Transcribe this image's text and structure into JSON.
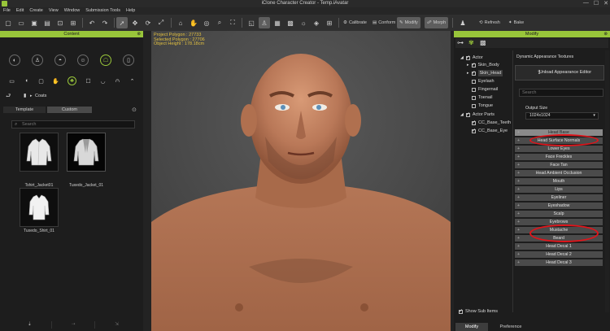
{
  "window": {
    "title": "iClone Character Creator - Temp.iAvatar",
    "controls": [
      "—",
      "☐",
      "✕"
    ]
  },
  "menu": [
    "File",
    "Edit",
    "Create",
    "View",
    "Window",
    "Submission Tools",
    "Help"
  ],
  "toolbar": {
    "calibrate": "Calibrate",
    "conform": "Conform",
    "modify": "Modify",
    "morph": "Morph",
    "refresh": "Refresh",
    "bake": "Bake"
  },
  "content_panel": {
    "title": "Content",
    "path": "Coats",
    "tabs": [
      "Template",
      "Custom"
    ],
    "search_placeholder": "Search",
    "items": [
      {
        "label": "Tshirt_Jacket01",
        "selected": false
      },
      {
        "label": "Tuxedo_Jacket_01",
        "selected": true
      },
      {
        "label": "Tuxedo_Shirt_01",
        "selected": false
      }
    ]
  },
  "viewport": {
    "stats": [
      "Project Polygon : 27733",
      "Selected Polygon : 27706",
      "Object Height : 178.18cm"
    ]
  },
  "modify_panel": {
    "title": "Modify",
    "tree": [
      {
        "label": "Actor",
        "level": 0,
        "checked": true,
        "expanded": true
      },
      {
        "label": "Skin_Body",
        "level": 1,
        "checked": true
      },
      {
        "label": "Skin_Head",
        "level": 1,
        "checked": true,
        "selected": true
      },
      {
        "label": "Eyelash",
        "level": 1,
        "checked": false
      },
      {
        "label": "Fingernail",
        "level": 1,
        "checked": false
      },
      {
        "label": "Toenail",
        "level": 1,
        "checked": false
      },
      {
        "label": "Tongue",
        "level": 1,
        "checked": false
      },
      {
        "label": "Actor Parts",
        "level": 0,
        "checked": true,
        "expanded": true
      },
      {
        "label": "CC_Base_Teeth",
        "level": 1,
        "checked": true
      },
      {
        "label": "CC_Base_Eye",
        "level": 1,
        "checked": true
      }
    ],
    "dynamic_title": "Dynamic Appearance Textures",
    "unload_button": "Unload Appearance Editor",
    "search_placeholder": "Search",
    "output_size_label": "Output Size",
    "output_size_value": "1024x1024",
    "texture_layers": [
      "Head Base",
      "Head Surface Normals",
      "Lower Eyes",
      "Face Freckles",
      "Face Tan",
      "Head Ambient Occlusion",
      "Mouth",
      "Lips",
      "Eyeliner",
      "Eyeshadow",
      "Scalp",
      "Eyebrows",
      "Mustache",
      "Beard",
      "Head Decal 1",
      "Head Decal 2",
      "Head Decal 3"
    ],
    "show_sub_items": "Show Sub Items",
    "bottom_tabs": [
      "Modify",
      "Preference"
    ]
  },
  "colors": {
    "accent": "#98c53a",
    "highlight": "#e0141a",
    "stats_text": "#e2c040"
  }
}
